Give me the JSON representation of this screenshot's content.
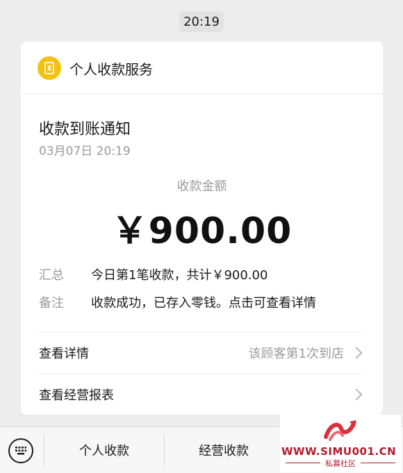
{
  "time_chip": "20:19",
  "service": {
    "name": "个人收款服务",
    "logo_icon": "receipt-yuan-icon",
    "logo_color": "#f4c20d"
  },
  "notice": {
    "title": "收款到账通知",
    "datetime": "03月07日 20:19",
    "amount_label": "收款金额",
    "amount": "￥900.00",
    "summary_key": "汇总",
    "summary_value": "今日第1笔收款，共计￥900.00",
    "remark_key": "备注",
    "remark_value": "收款成功，已存入零钱。点击可查看详情"
  },
  "links": {
    "details_label": "查看详情",
    "details_extra": "该顾客第1次到店",
    "report_label": "查看经营报表"
  },
  "bottom_menu": {
    "keyboard_icon": "keyboard-icon",
    "items": [
      "个人收款",
      "经营收款"
    ]
  },
  "watermark": {
    "url": "WWW.SIMU001.CN",
    "subtitle": "私募社区",
    "color": "#b31b2b"
  }
}
